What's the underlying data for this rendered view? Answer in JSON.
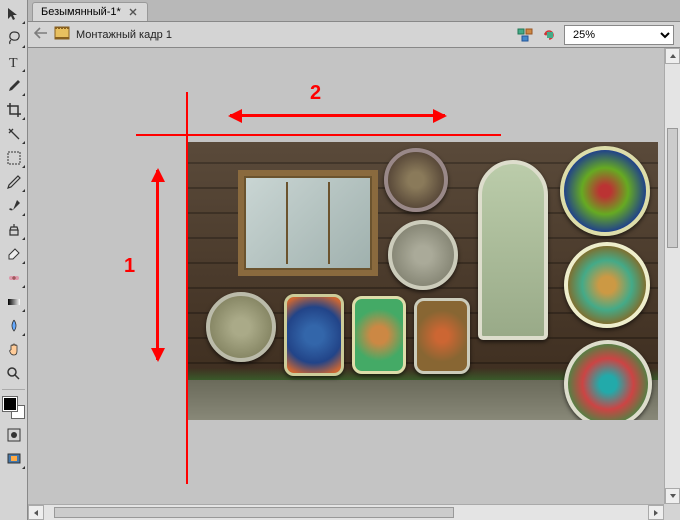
{
  "tabs": [
    {
      "label": "Безымянный-1*"
    }
  ],
  "document": {
    "nav_back": "⇐",
    "title": "Монтажный кадр 1"
  },
  "toolbar_right": {
    "zoom_value": "25%"
  },
  "annotations": {
    "label1": "1",
    "label2": "2"
  },
  "tools": [
    "move",
    "lasso",
    "text",
    "eyedropper",
    "crop",
    "wand",
    "pencil",
    "brush",
    "clone",
    "eraser",
    "heal",
    "gradient",
    "blur",
    "sponge",
    "hand",
    "zoom"
  ],
  "colors": {
    "guide": "#ff0000"
  }
}
